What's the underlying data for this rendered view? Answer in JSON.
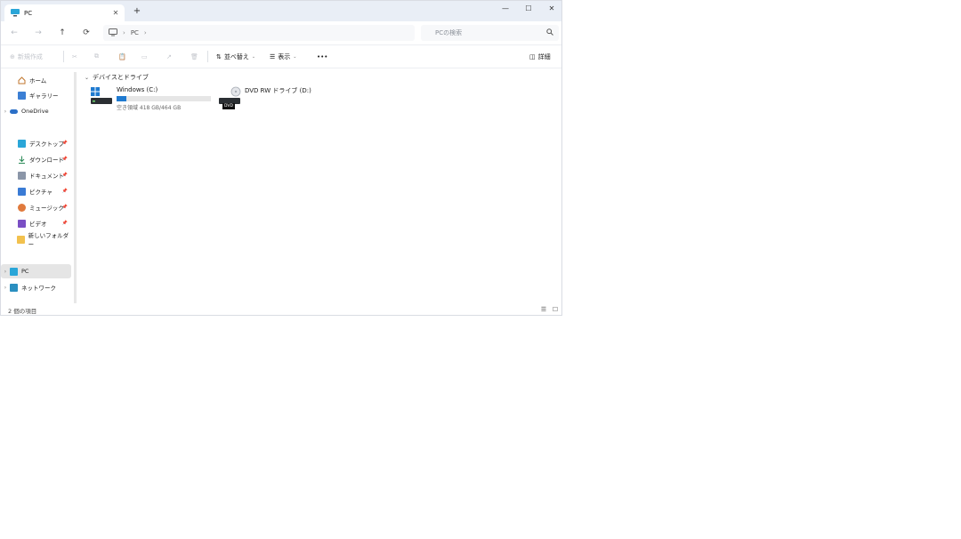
{
  "tab": {
    "title": "PC",
    "close": "✕",
    "new_tab": "+"
  },
  "window_controls": {
    "minimize": "—",
    "maximize": "☐",
    "close": "✕"
  },
  "address": {
    "back": "←",
    "forward": "→",
    "up": "↑",
    "refresh": "⟳",
    "breadcrumb_sep": "›",
    "breadcrumb": "PC",
    "breadcrumb_end": "›",
    "search_placeholder": "PCの検索"
  },
  "command_bar": {
    "new": "新規作成",
    "sort": "並べ替え",
    "view": "表示",
    "more": "•••",
    "details": "詳細"
  },
  "sidebar": {
    "items": [
      {
        "label": "ホーム",
        "icon": "home-icon"
      },
      {
        "label": "ギャラリー",
        "icon": "gallery-icon"
      },
      {
        "label": "OneDrive",
        "icon": "cloud-icon"
      },
      {
        "label": "デスクトップ",
        "icon": "desktop-icon"
      },
      {
        "label": "ダウンロード",
        "icon": "download-icon"
      },
      {
        "label": "ドキュメント",
        "icon": "document-icon"
      },
      {
        "label": "ピクチャ",
        "icon": "picture-icon"
      },
      {
        "label": "ミュージック",
        "icon": "music-icon"
      },
      {
        "label": "ビデオ",
        "icon": "video-icon"
      },
      {
        "label": "新しいフォルダー",
        "icon": "folder-icon"
      },
      {
        "label": "PC",
        "icon": "pc-icon"
      },
      {
        "label": "ネットワーク",
        "icon": "network-icon"
      }
    ],
    "pin": "📌",
    "chevron": "›"
  },
  "main": {
    "group_title": "デバイスとドライブ",
    "group_chevron": "⌄",
    "drives": [
      {
        "name": "Windows (C:)",
        "free_text": "空き領域 418 GB/464 GB",
        "used_fraction": 0.1
      },
      {
        "name": "DVD RW ドライブ (D:)",
        "badge": "DVD"
      }
    ]
  },
  "status_bar": {
    "count": "2 個の項目"
  },
  "colors": {
    "accent": "#1f7ad0",
    "titlebar": "#e9eef6"
  }
}
